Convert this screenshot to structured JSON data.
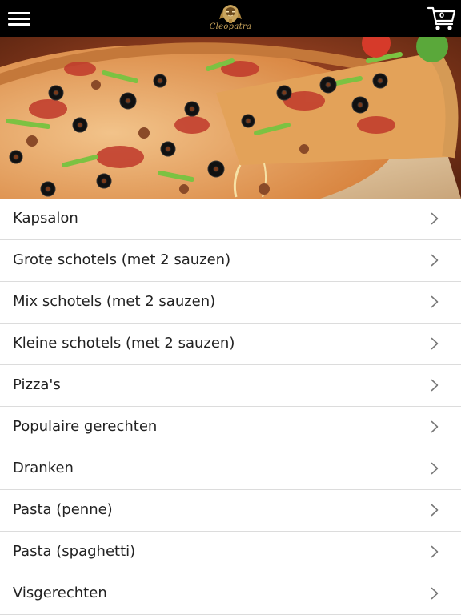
{
  "header": {
    "brand_name": "Cleopatra",
    "cart_count": "0",
    "menu_icon": "hamburger-menu-icon",
    "cart_icon": "shopping-cart-icon"
  },
  "hero": {
    "image_subject": "pizza"
  },
  "categories": [
    {
      "label": "Kapsalon"
    },
    {
      "label": "Grote schotels (met 2 sauzen)"
    },
    {
      "label": "Mix schotels (met 2 sauzen)"
    },
    {
      "label": "Kleine schotels (met 2 sauzen)"
    },
    {
      "label": "Pizza's"
    },
    {
      "label": "Populaire gerechten"
    },
    {
      "label": "Dranken"
    },
    {
      "label": "Pasta (penne)"
    },
    {
      "label": "Pasta (spaghetti)"
    },
    {
      "label": "Visgerechten"
    }
  ],
  "colors": {
    "header_background": "#000000",
    "header_icons": "#ffffff",
    "logo_gold": "#c9a45c",
    "list_divider": "#dcdcdc",
    "list_text": "#222222",
    "chevron": "#777777"
  }
}
